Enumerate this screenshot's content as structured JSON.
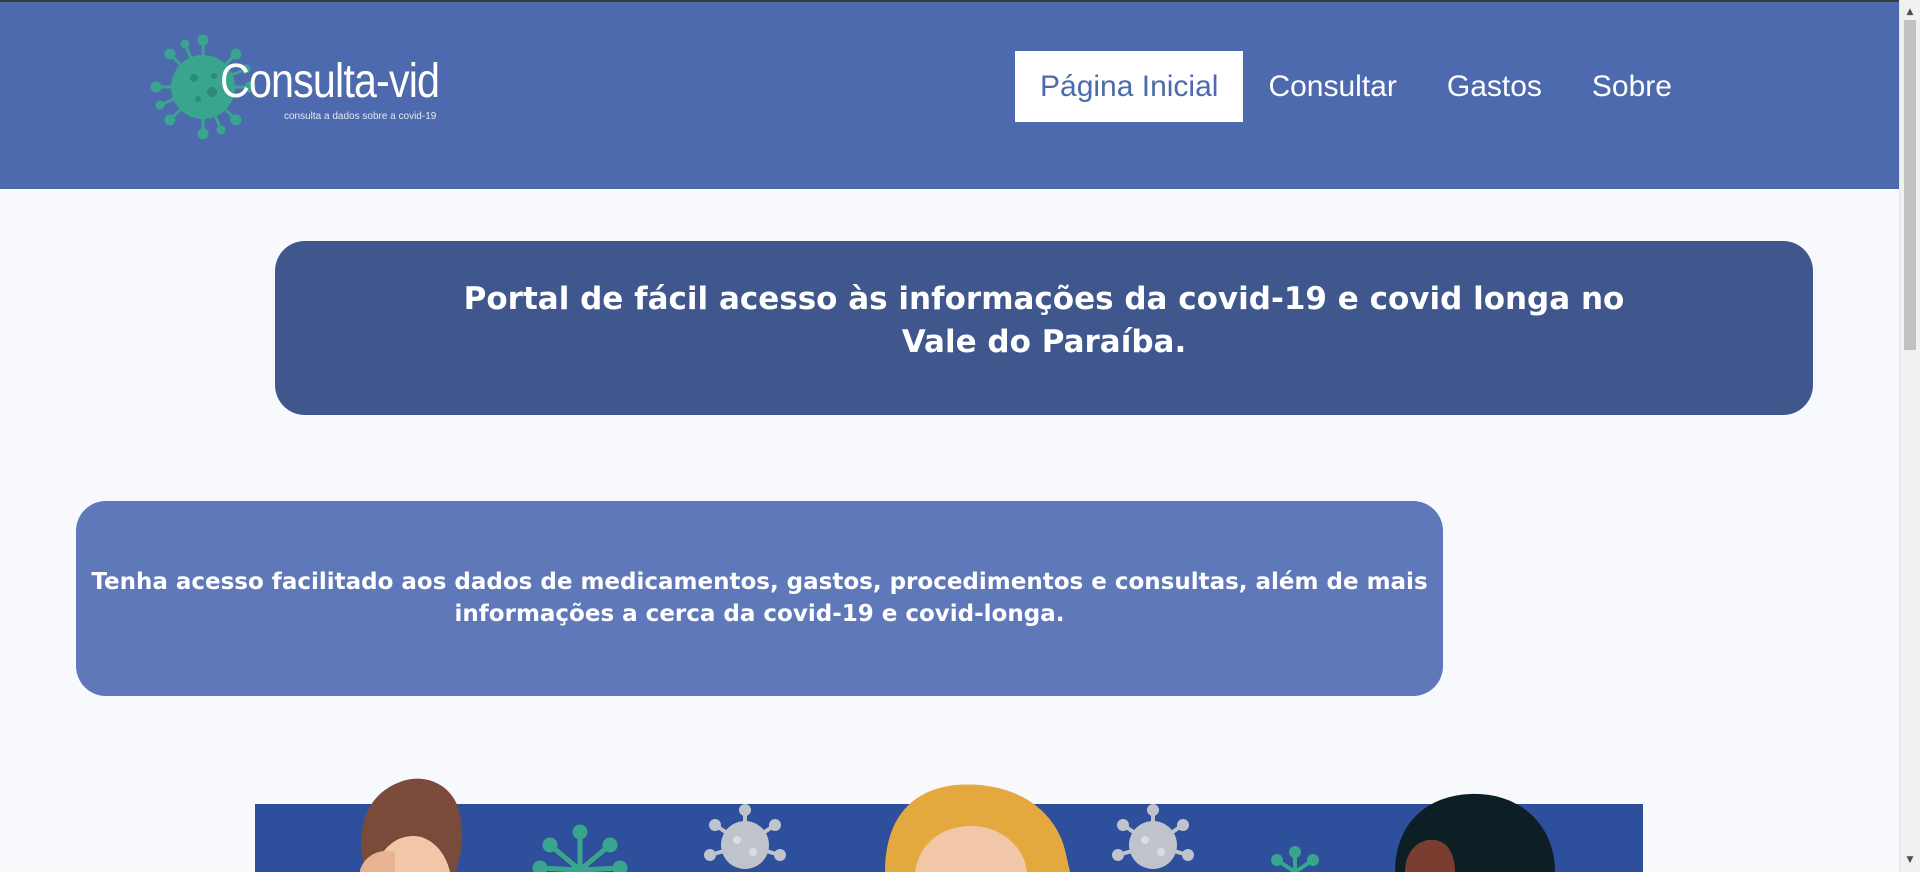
{
  "header": {
    "logo": {
      "title": "Consulta-vid",
      "subtitle": "consulta a dados sobre a covid-19",
      "icon": "virus-icon"
    },
    "nav": [
      {
        "label": "Página Inicial",
        "active": true
      },
      {
        "label": "Consultar",
        "active": false
      },
      {
        "label": "Gastos",
        "active": false
      },
      {
        "label": "Sobre",
        "active": false
      }
    ]
  },
  "main": {
    "banner_title": "Portal de fácil acesso às informações da covid-19 e covid longa no Vale do Paraíba.",
    "banner_description": "Tenha acesso facilitado aos dados de medicamentos, gastos, procedimentos e consultas, além de mais informações a cerca da covid-19 e covid-longa."
  },
  "colors": {
    "header_bg": "#4e6aae",
    "banner_title_bg": "#3f578d",
    "banner_description_bg": "#5e78ba",
    "illustration_bg": "#2e4f9c",
    "virus_green": "#3aa58e",
    "virus_gray": "#bfc4cc"
  }
}
